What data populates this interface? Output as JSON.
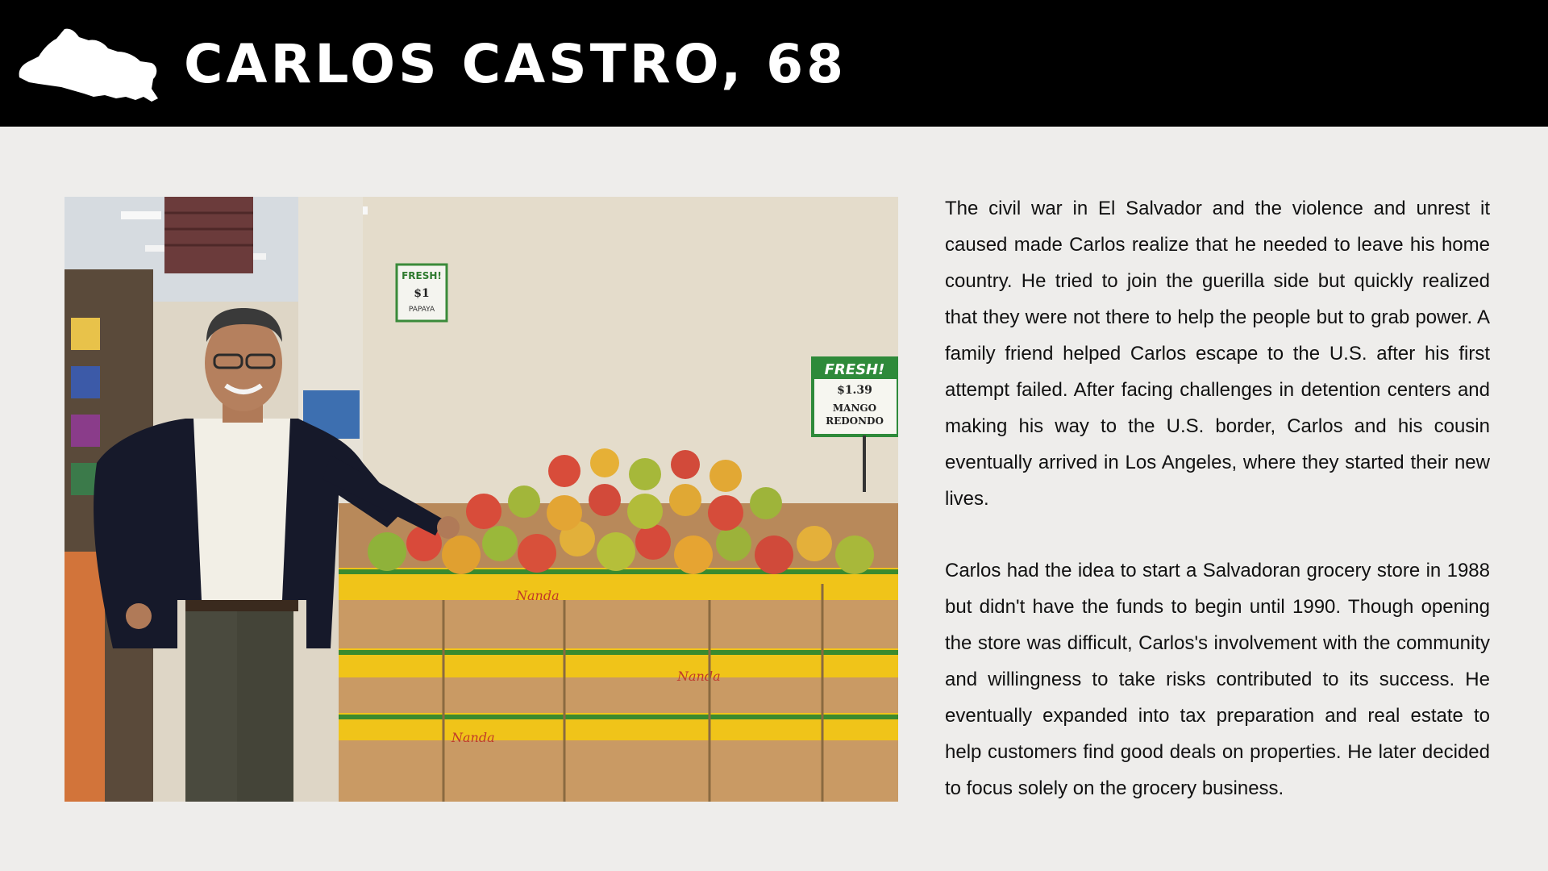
{
  "header": {
    "title": "CARLOS CASTRO, 68",
    "icon": "el-salvador-map-icon"
  },
  "photo": {
    "signs": {
      "left_sign_title": "FRESH!",
      "left_sign_price": "$1",
      "left_sign_item": "PAPAYA",
      "right_sign_title": "FRESH!",
      "right_sign_price": "$1.39",
      "right_sign_line1": "MANGO",
      "right_sign_line2": "REDONDO"
    },
    "box_label": "Nanda"
  },
  "story": {
    "paragraphs": [
      "The civil war in El Salvador and the violence and unrest it caused made Carlos realize that he needed to leave his home country. He tried to join the guerilla side but quickly realized that they were not there to help the people but to grab power. A family friend helped Carlos escape to the U.S. after his first attempt failed. After facing challenges in detention centers and making his way to the U.S. border, Carlos and his cousin eventually arrived in Los Angeles, where they started their new lives.",
      "Carlos had the idea to start a Salvadoran grocery store in 1988 but didn't have the funds to begin until 1990. Though opening the store was difficult, Carlos's involvement with the community and willingness to take risks contributed to its success. He eventually expanded into tax preparation and real estate to help customers find good deals on properties. He later decided to focus solely on the grocery business."
    ]
  }
}
